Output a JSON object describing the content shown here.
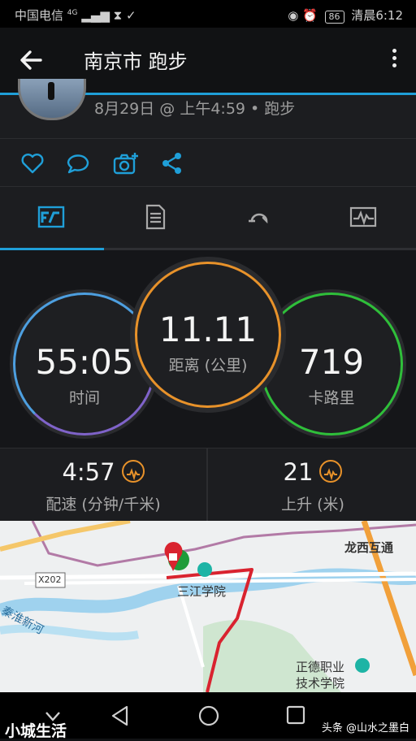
{
  "status_bar": {
    "carrier": "中国电信",
    "network": "4G",
    "battery": "86",
    "time": "清晨6:12"
  },
  "app_bar": {
    "title": "南京市 跑步"
  },
  "activity": {
    "date_line": "8月29日 @ 上午4:59 • 跑步"
  },
  "stats": {
    "time": {
      "value": "55:05",
      "label": "时间",
      "color": "#7f63c9"
    },
    "distance": {
      "value": "11.11",
      "label": "距离 (公里)",
      "color": "#e8922a"
    },
    "calories": {
      "value": "719",
      "label": "卡路里",
      "color": "#2fbf3a"
    }
  },
  "metrics": {
    "pace": {
      "value": "4:57",
      "label": "配速 (分钟/千米)"
    },
    "ascent": {
      "value": "21",
      "label": "上升 (米)"
    }
  },
  "map": {
    "labels": {
      "interchange": "龙西互通",
      "road_code": "X202",
      "college": "三江学院",
      "river": "秦淮新河",
      "vocational_line1": "正德职业",
      "vocational_line2": "技术学院"
    }
  },
  "colors": {
    "accent": "#1f9fd8",
    "route": "#d9232f"
  },
  "watermark": {
    "left": "小城生活",
    "right": "头条 @山水之墨白"
  }
}
